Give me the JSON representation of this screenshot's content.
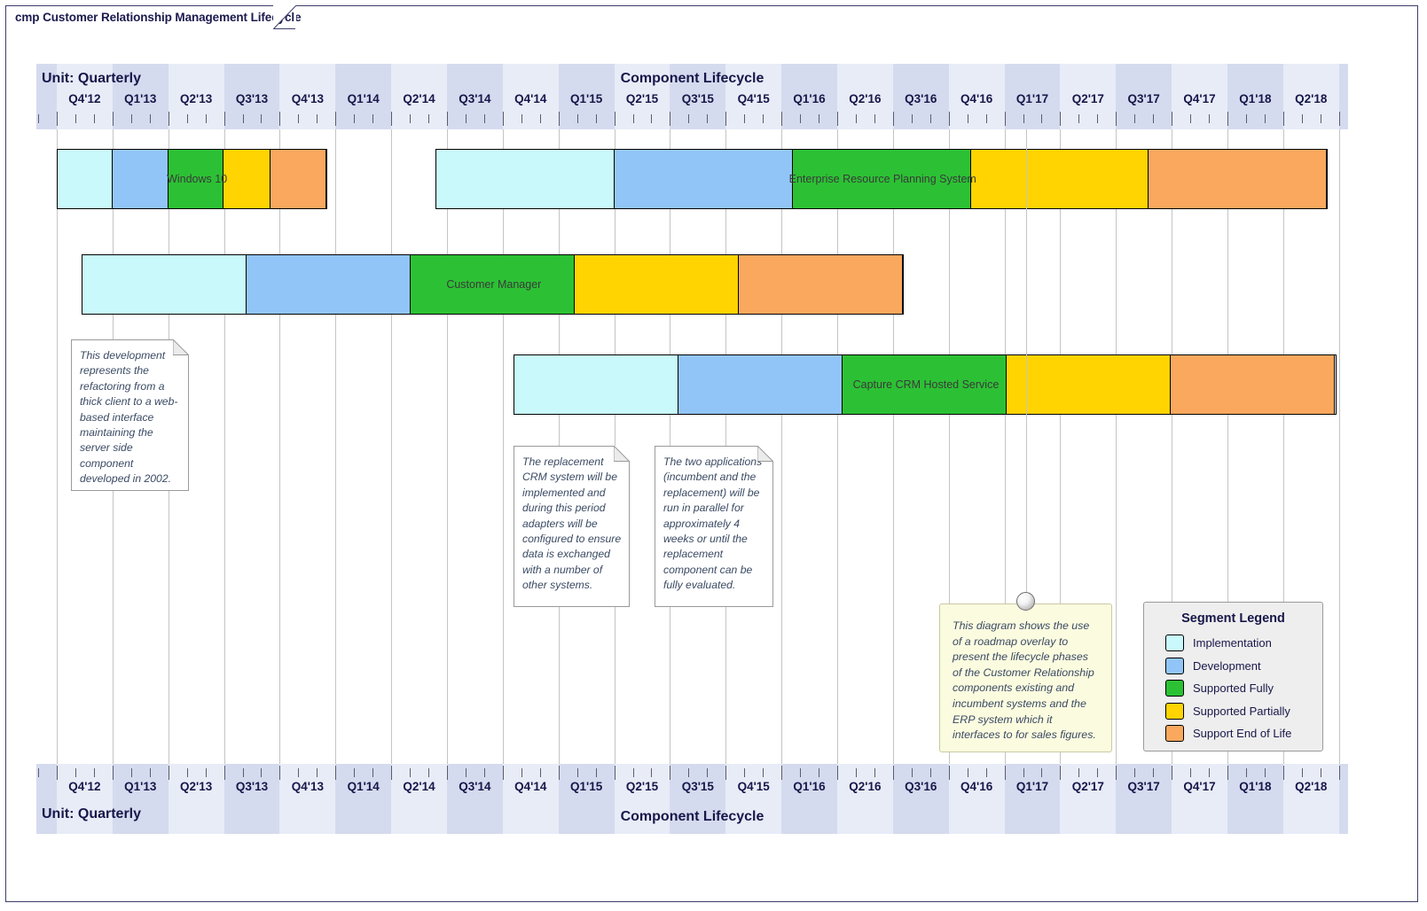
{
  "frame": {
    "tab_label": "cmp Customer Relationship Management Lifecycle"
  },
  "timeline": {
    "unit_label": "Unit: Quarterly",
    "title": "Component Lifecycle",
    "quarters": [
      "Q4'12",
      "Q1'13",
      "Q2'13",
      "Q3'13",
      "Q4'13",
      "Q1'14",
      "Q2'14",
      "Q3'14",
      "Q4'14",
      "Q1'15",
      "Q2'15",
      "Q3'15",
      "Q4'15",
      "Q1'16",
      "Q2'16",
      "Q3'16",
      "Q4'16",
      "Q1'17",
      "Q2'17",
      "Q3'17",
      "Q4'17",
      "Q1'18",
      "Q2'18"
    ]
  },
  "colors": {
    "implementation": "#c9f9fb",
    "development": "#92c5f7",
    "supported_fully": "#2cc134",
    "supported_partially": "#ffd400",
    "support_end_of_life": "#f9a85e",
    "band_light": "#e8ecf7",
    "band_dark": "#d5dbee",
    "bar_border": "#000000",
    "text_dark": "#17174a"
  },
  "bars": [
    {
      "name": "Windows 10",
      "label": "Windows 10",
      "start_q": 0,
      "segments": [
        {
          "phase": "Implementation",
          "quarters": 1
        },
        {
          "phase": "Development",
          "quarters": 1
        },
        {
          "phase": "Supported Fully",
          "quarters": 1
        },
        {
          "phase": "Supported Partially",
          "quarters": 0.85
        },
        {
          "phase": "Support End of Life",
          "quarters": 1
        }
      ]
    },
    {
      "name": "Enterprise Resource Planning System",
      "label": "Enterprise Resource Planning System",
      "start_q": 6.8,
      "segments": [
        {
          "phase": "Implementation",
          "quarters": 3.2
        },
        {
          "phase": "Development",
          "quarters": 3.2
        },
        {
          "phase": "Supported Fully",
          "quarters": 3.2
        },
        {
          "phase": "Supported Partially",
          "quarters": 3.2
        },
        {
          "phase": "Support End of Life",
          "quarters": 3.2
        }
      ]
    },
    {
      "name": "Customer Manager",
      "label": "Customer Manager",
      "start_q": 0.45,
      "segments": [
        {
          "phase": "Implementation",
          "quarters": 2.95
        },
        {
          "phase": "Development",
          "quarters": 2.95
        },
        {
          "phase": "Supported Fully",
          "quarters": 2.95
        },
        {
          "phase": "Supported Partially",
          "quarters": 2.95
        },
        {
          "phase": "Support End of Life",
          "quarters": 2.95
        }
      ]
    },
    {
      "name": "Capture CRM Hosted Service",
      "label": "Capture CRM Hosted Service",
      "start_q": 8.2,
      "segments": [
        {
          "phase": "Implementation",
          "quarters": 2.95
        },
        {
          "phase": "Development",
          "quarters": 2.95
        },
        {
          "phase": "Supported Fully",
          "quarters": 2.95
        },
        {
          "phase": "Supported Partially",
          "quarters": 2.95
        },
        {
          "phase": "Support End of Life",
          "quarters": 2.95
        }
      ]
    }
  ],
  "notes": [
    {
      "id": "note-refactoring",
      "text": "This development represents the refactoring from a thick client to a web-based interface maintaining the server side component developed in 2002."
    },
    {
      "id": "note-replacement-crm",
      "text": "The replacement CRM system will be implemented and during this period adapters will be configured to ensure data is exchanged with a number of other systems."
    },
    {
      "id": "note-parallel-run",
      "text": "The two applications (incumbent and the replacement) will be run in parallel for approximately 4 weeks or until the replacement component can be fully evaluated."
    }
  ],
  "sticky_note": {
    "text": "This diagram shows the use of a roadmap overlay to present the lifecycle phases of the Customer Relationship components existing and incumbent systems and the ERP system which it interfaces to for sales figures."
  },
  "legend": {
    "title": "Segment Legend",
    "items": [
      {
        "label": "Implementation",
        "color": "#c9f9fb"
      },
      {
        "label": "Development",
        "color": "#92c5f7"
      },
      {
        "label": "Supported Fully",
        "color": "#2cc134"
      },
      {
        "label": "Supported Partially",
        "color": "#ffd400"
      },
      {
        "label": "Support End of Life",
        "color": "#f9a85e"
      }
    ]
  }
}
